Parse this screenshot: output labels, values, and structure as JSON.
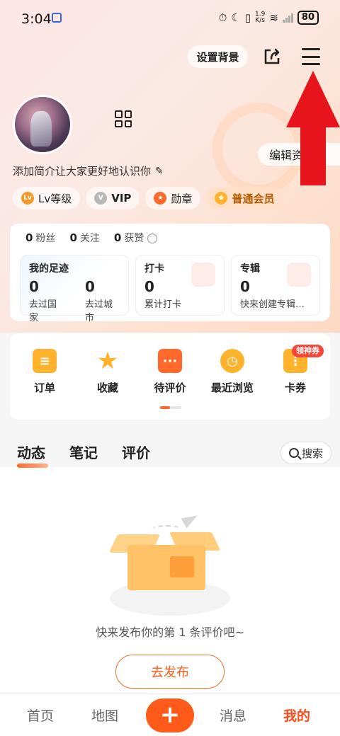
{
  "status_bar": {
    "time": "3:04",
    "net_speed_value": "1.9",
    "net_speed_unit": "K/s",
    "battery": "80"
  },
  "header": {
    "set_background_label": "设置背景"
  },
  "profile": {
    "edit_profile_label": "编辑资",
    "bio": "添加简介让大家更好地认识你",
    "tags": {
      "lv_icon": "Lv",
      "lv": "Lv等级",
      "vip_icon": "V",
      "vip": "VIP",
      "medal": "勋章",
      "member": "普通会员"
    }
  },
  "stats": {
    "fans_count": "0",
    "fans_label": "粉丝",
    "following_count": "0",
    "following_label": "关注",
    "likes_count": "0",
    "likes_label": "获赞",
    "footprint": {
      "title": "我的足迹",
      "countries_count": "0",
      "countries_label": "去过国家",
      "cities_count": "0",
      "cities_label": "去过城市"
    },
    "checkin": {
      "title": "打卡",
      "count": "0",
      "label": "累计打卡"
    },
    "album": {
      "title": "专辑",
      "count": "0",
      "label": "快来创建专辑…"
    }
  },
  "actions": {
    "orders": "订单",
    "favorites": "收藏",
    "to_review": "待评价",
    "recent": "最近浏览",
    "coupons": "卡券",
    "coupon_badge": "领神券"
  },
  "content_tabs": {
    "moments": "动态",
    "notes": "笔记",
    "reviews": "评价",
    "search": "搜索"
  },
  "empty_state": {
    "message": "快来发布你的第 1 条评价吧~",
    "publish_label": "去发布"
  },
  "bottom_nav": {
    "home": "首页",
    "map": "地图",
    "plus": "+",
    "messages": "消息",
    "mine": "我的"
  },
  "colors": {
    "accent": "#ff5a1a",
    "arrow_red": "#e8141c"
  }
}
